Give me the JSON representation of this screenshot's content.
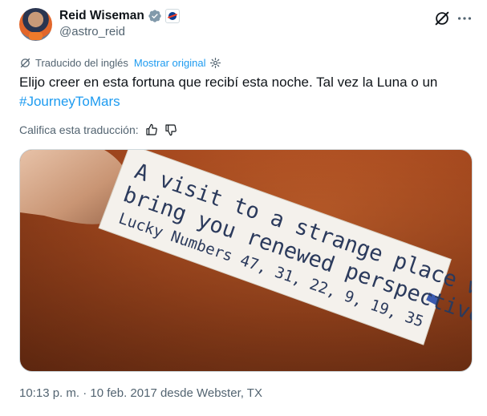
{
  "author": {
    "display_name": "Reid Wiseman",
    "handle": "@astro_reid"
  },
  "translation": {
    "label": "Traducido del inglés",
    "show_original": "Mostrar original"
  },
  "tweet": {
    "text": "Elijo creer en esta fortuna que recibí esta noche. Tal vez la Luna o un ",
    "hashtag": "#JourneyToMars"
  },
  "rating": {
    "label": "Califica esta traducción:"
  },
  "media": {
    "fortune_line1": "A visit to a strange place will",
    "fortune_line2": "bring you renewed perspective.",
    "fortune_line3": "Lucky Numbers 47, 31, 22, 9, 19, 35"
  },
  "meta": {
    "timestamp": "10:13 p. m. · 10 feb. 2017 desde Webster, TX"
  },
  "colors": {
    "accent": "#1d9bf0",
    "secondary_text": "#536471",
    "verified": "#829aab"
  },
  "icons": {
    "verified": "verified-badge-icon",
    "affiliation": "nasa-affiliation-icon",
    "grok": "grok-icon",
    "more": "more-icon",
    "translate": "translate-icon",
    "settings": "gear-icon",
    "thumbs_up": "thumbs-up-icon",
    "thumbs_down": "thumbs-down-icon"
  }
}
